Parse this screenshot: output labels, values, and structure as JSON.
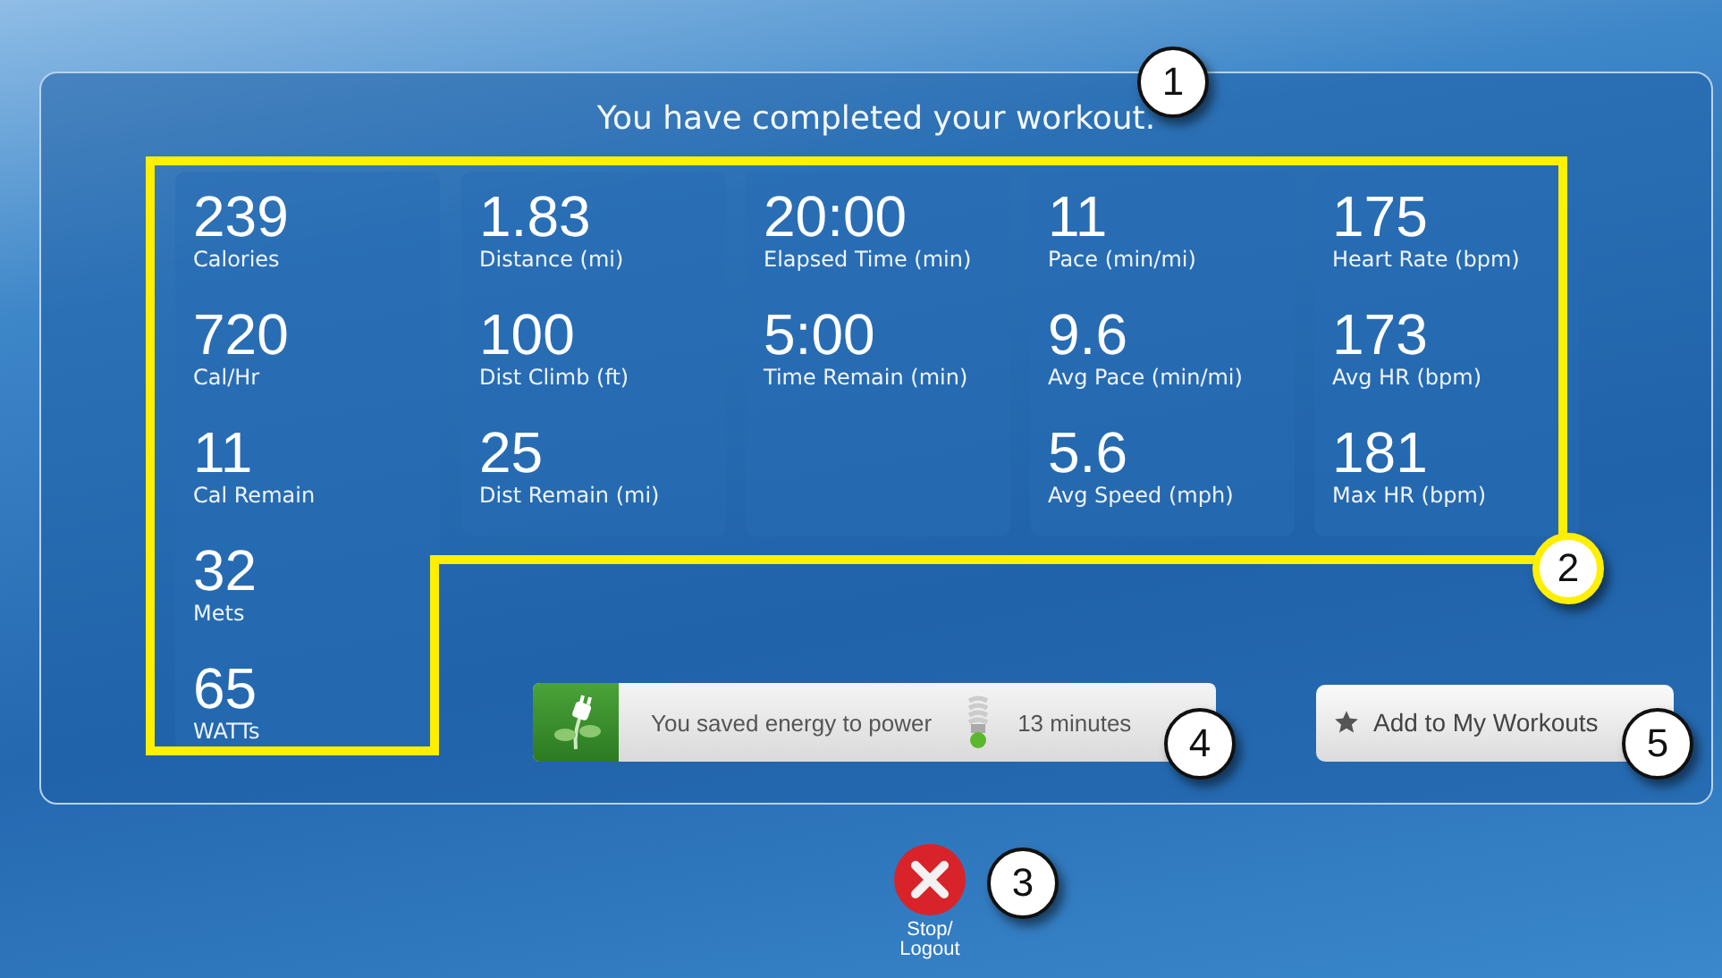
{
  "title": "You have completed your workout.",
  "stat_columns": [
    {
      "stats": [
        {
          "value": "239",
          "label": "Calories"
        },
        {
          "value": "720",
          "label": "Cal/Hr"
        },
        {
          "value": "11",
          "label": "Cal Remain"
        },
        {
          "value": "32",
          "label": "Mets"
        },
        {
          "value": "65",
          "label": "WATTs"
        }
      ]
    },
    {
      "stats": [
        {
          "value": "1.83",
          "label": "Distance (mi)"
        },
        {
          "value": "100",
          "label": "Dist Climb (ft)"
        },
        {
          "value": "25",
          "label": "Dist Remain (mi)"
        }
      ]
    },
    {
      "stats": [
        {
          "value": "20:00",
          "label": "Elapsed Time (min)"
        },
        {
          "value": "5:00",
          "label": "Time Remain (min)"
        }
      ]
    },
    {
      "stats": [
        {
          "value": "11",
          "label": "Pace (min/mi)"
        },
        {
          "value": "9.6",
          "label": "Avg Pace (min/mi)"
        },
        {
          "value": "5.6",
          "label": "Avg Speed (mph)"
        }
      ]
    },
    {
      "stats": [
        {
          "value": "175",
          "label": "Heart Rate (bpm)"
        },
        {
          "value": "173",
          "label": "Avg HR (bpm)"
        },
        {
          "value": "181",
          "label": "Max HR (bpm)"
        }
      ]
    }
  ],
  "energy": {
    "text": "You saved energy to power",
    "amount": "13 minutes"
  },
  "add_button": {
    "label": "Add to My Workouts"
  },
  "stop_button": {
    "label": "Stop/ Logout"
  },
  "callouts": [
    {
      "number": "1",
      "highlighted": false
    },
    {
      "number": "2",
      "highlighted": true
    },
    {
      "number": "3",
      "highlighted": false
    },
    {
      "number": "4",
      "highlighted": false
    },
    {
      "number": "5",
      "highlighted": false
    }
  ]
}
